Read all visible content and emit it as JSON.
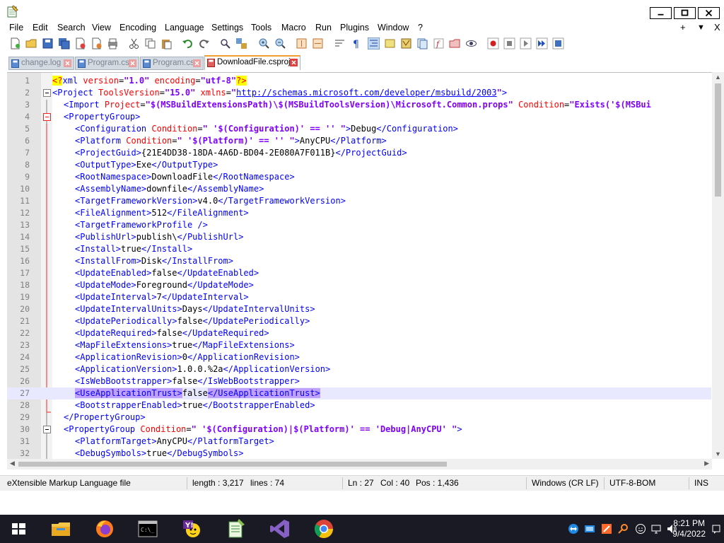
{
  "menu": [
    "File",
    "Edit",
    "Search",
    "View",
    "Encoding",
    "Language",
    "Settings",
    "Tools",
    "Macro",
    "Run",
    "Plugins",
    "Window",
    "?"
  ],
  "menu_right": [
    "+",
    "▼",
    "X"
  ],
  "tabs": [
    {
      "label": "change.log",
      "active": false
    },
    {
      "label": "Program.cs",
      "active": false
    },
    {
      "label": "Program.cs",
      "active": false
    },
    {
      "label": "DownloadFile.csproj",
      "active": true
    }
  ],
  "lines": [
    {
      "n": "1"
    },
    {
      "n": "2"
    },
    {
      "n": "3"
    },
    {
      "n": "4"
    },
    {
      "n": "5"
    },
    {
      "n": "6"
    },
    {
      "n": "7"
    },
    {
      "n": "8"
    },
    {
      "n": "9"
    },
    {
      "n": "10"
    },
    {
      "n": "11"
    },
    {
      "n": "12"
    },
    {
      "n": "13"
    },
    {
      "n": "14"
    },
    {
      "n": "15"
    },
    {
      "n": "16"
    },
    {
      "n": "17"
    },
    {
      "n": "18"
    },
    {
      "n": "19"
    },
    {
      "n": "20"
    },
    {
      "n": "21"
    },
    {
      "n": "22"
    },
    {
      "n": "23"
    },
    {
      "n": "24"
    },
    {
      "n": "25"
    },
    {
      "n": "26"
    },
    {
      "n": "27"
    },
    {
      "n": "28"
    },
    {
      "n": "29"
    },
    {
      "n": "30"
    },
    {
      "n": "31"
    },
    {
      "n": "32"
    }
  ],
  "code": {
    "l1": {
      "open": "<?",
      "tag": "xml",
      "a1": " version",
      "eq1": "=",
      "v1": "\"1.0\"",
      "a2": " encoding",
      "eq2": "=",
      "v2": "\"utf-8\"",
      "close": "?>"
    },
    "l2": {
      "o": "<",
      "tag": "Project",
      "a1": " ToolsVersion",
      "eq": "=",
      "v1": "\"15.0\"",
      "a2": " xmlns",
      "eq2": "=",
      "q1": "\"",
      "url": "http://schemas.microsoft.com/developer/msbuild/2003",
      "q2": "\"",
      "c": ">"
    },
    "l3": {
      "o": "<",
      "tag": "Import",
      "a1": " Project",
      "eq": "=",
      "v1": "\"$(MSBuildExtensionsPath)\\$(MSBuildToolsVersion)\\Microsoft.Common.props\"",
      "a2": " Condition",
      "eq2": "=",
      "v2": "\"Exists('$(MSBui"
    },
    "l4": {
      "text": "<PropertyGroup>"
    },
    "l5": {
      "o": "<Configuration",
      "a": " Condition",
      "eq": "=",
      "v": "\" '$(Configuration)' == '' \"",
      "c": ">",
      "x": "Debug",
      "e": "</Configuration>"
    },
    "l6": {
      "o": "<Platform",
      "a": " Condition",
      "eq": "=",
      "v": "\" '$(Platform)' == '' \"",
      "c": ">",
      "x": "AnyCPU",
      "e": "</Platform>"
    },
    "l7": {
      "o": "<ProjectGuid>",
      "x": "{21E4DD38-18DA-4A6D-BD04-2E080A7F011B}",
      "e": "</ProjectGuid>"
    },
    "l8": {
      "o": "<OutputType>",
      "x": "Exe",
      "e": "</OutputType>"
    },
    "l9": {
      "o": "<RootNamespace>",
      "x": "DownloadFile",
      "e": "</RootNamespace>"
    },
    "l10": {
      "o": "<AssemblyName>",
      "x": "downfile",
      "e": "</AssemblyName>"
    },
    "l11": {
      "o": "<TargetFrameworkVersion>",
      "x": "v4.0",
      "e": "</TargetFrameworkVersion>"
    },
    "l12": {
      "o": "<FileAlignment>",
      "x": "512",
      "e": "</FileAlignment>"
    },
    "l13": {
      "text": "<TargetFrameworkProfile />"
    },
    "l14": {
      "o": "<PublishUrl>",
      "x": "publish\\",
      "e": "</PublishUrl>"
    },
    "l15": {
      "o": "<Install>",
      "x": "true",
      "e": "</Install>"
    },
    "l16": {
      "o": "<InstallFrom>",
      "x": "Disk",
      "e": "</InstallFrom>"
    },
    "l17": {
      "o": "<UpdateEnabled>",
      "x": "false",
      "e": "</UpdateEnabled>"
    },
    "l18": {
      "o": "<UpdateMode>",
      "x": "Foreground",
      "e": "</UpdateMode>"
    },
    "l19": {
      "o": "<UpdateInterval>",
      "x": "7",
      "e": "</UpdateInterval>"
    },
    "l20": {
      "o": "<UpdateIntervalUnits>",
      "x": "Days",
      "e": "</UpdateIntervalUnits>"
    },
    "l21": {
      "o": "<UpdatePeriodically>",
      "x": "false",
      "e": "</UpdatePeriodically>"
    },
    "l22": {
      "o": "<UpdateRequired>",
      "x": "false",
      "e": "</UpdateRequired>"
    },
    "l23": {
      "o": "<MapFileExtensions>",
      "x": "true",
      "e": "</MapFileExtensions>"
    },
    "l24": {
      "o": "<ApplicationRevision>",
      "x": "0",
      "e": "</ApplicationRevision>"
    },
    "l25": {
      "o": "<ApplicationVersion>",
      "x": "1.0.0.%2a",
      "e": "</ApplicationVersion>"
    },
    "l26": {
      "o": "<IsWebBootstrapper>",
      "x": "false",
      "e": "</IsWebBootstrapper>"
    },
    "l27": {
      "o": "<UseApplicationTrust>",
      "x": "false",
      "e": "</UseApplicationTrust>"
    },
    "l28": {
      "o": "<BootstrapperEnabled>",
      "x": "true",
      "e": "</BootstrapperEnabled>"
    },
    "l29": {
      "text": "</PropertyGroup>"
    },
    "l30": {
      "o": "<PropertyGroup",
      "a": " Condition",
      "eq": "=",
      "v": "\" '$(Configuration)|$(Platform)' == 'Debug|AnyCPU' \"",
      "c": ">"
    },
    "l31": {
      "o": "<PlatformTarget>",
      "x": "AnyCPU",
      "e": "</PlatformTarget>"
    },
    "l32": {
      "o": "<DebugSymbols>",
      "x": "true",
      "e": "</DebugSymbols>"
    }
  },
  "status": {
    "filetype": "eXtensible Markup Language file",
    "length": "length : 3,217",
    "lines": "lines : 74",
    "ln": "Ln : 27",
    "col": "Col : 40",
    "pos": "Pos : 1,436",
    "eol": "Windows (CR LF)",
    "encoding": "UTF-8-BOM",
    "mode": "INS"
  },
  "taskbar": {
    "time": "8:21 PM",
    "date": "9/4/2022"
  },
  "colors": {
    "tag": "#0000ff",
    "attr": "#ff0000",
    "value": "#8000ff",
    "taskbar": "#1a1a24"
  }
}
